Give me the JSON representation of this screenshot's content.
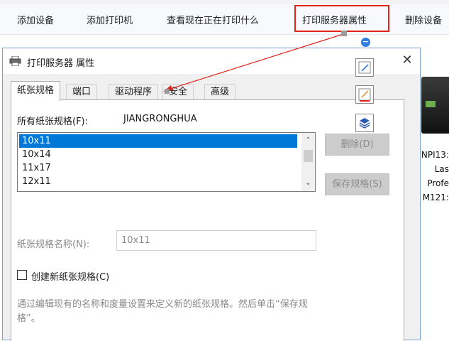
{
  "toolbar": {
    "commands": [
      {
        "label": "添加设备"
      },
      {
        "label": "添加打印机"
      },
      {
        "label": "查看现在正在打印什么"
      },
      {
        "label": "打印服务器属性"
      },
      {
        "label": "删除设备"
      }
    ],
    "highlight_color": "#e2231a"
  },
  "printer": {
    "name_lines": [
      "NPI13:",
      "Las",
      "Profe",
      "M121:"
    ]
  },
  "dialog": {
    "title": "打印服务器 属性",
    "title_icon": "printer-icon",
    "close_label": "✕",
    "tabs": [
      {
        "label": "纸张规格",
        "active": true
      },
      {
        "label": "端口",
        "active": false
      },
      {
        "label": "驱动程序",
        "active": false
      },
      {
        "label": "安全",
        "active": false
      },
      {
        "label": "高级",
        "active": false
      }
    ],
    "forms": {
      "all_forms_label": "所有纸张规格(F):",
      "server_name": "JIANGRONGHUA",
      "items": [
        "10x11",
        "10x14",
        "11x17",
        "12x11"
      ],
      "selected_item": "10x11",
      "delete_button": "删除(D)",
      "save_button": "保存规格(S)",
      "form_name_label": "纸张规格名称(N):",
      "form_name_value": "10x11",
      "create_new_label": "创建新纸张规格(C)",
      "create_new_checked": false,
      "help_text": "通过编辑现有的名称和度量设置来定义新的纸张规格。然后单击“保存规格”。"
    }
  },
  "annotation_tools": [
    {
      "icon": "pen-icon"
    },
    {
      "icon": "highlighter-icon"
    },
    {
      "icon": "layers-icon"
    }
  ],
  "colors": {
    "selection": "#0078d7",
    "annotation_arrow": "#e2231a"
  }
}
